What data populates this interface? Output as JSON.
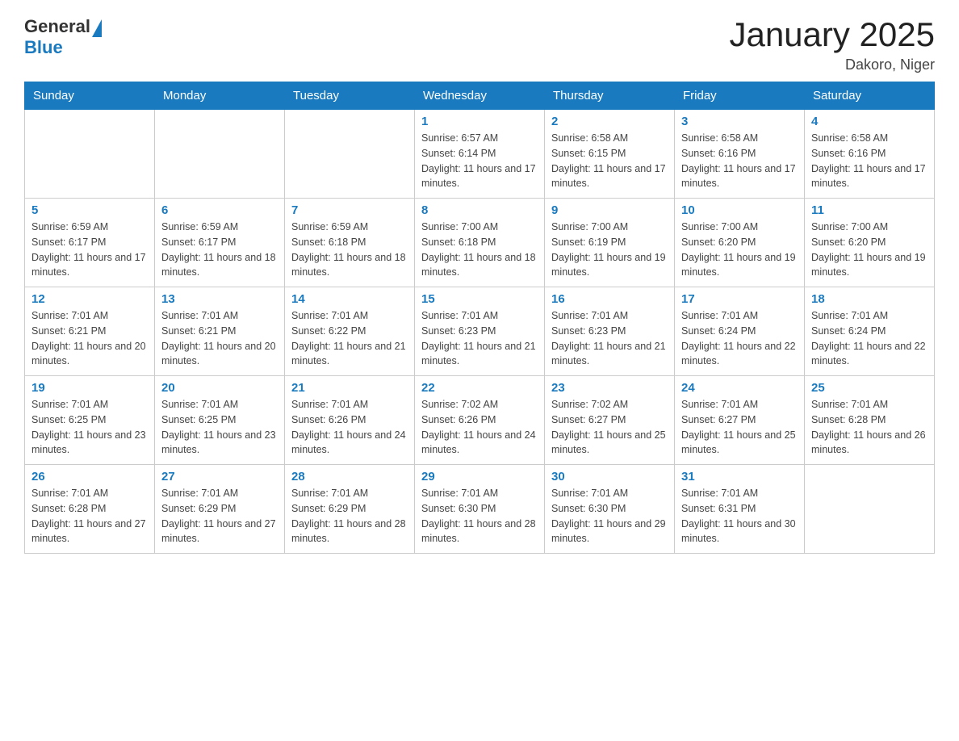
{
  "header": {
    "logo_general": "General",
    "logo_blue": "Blue",
    "title": "January 2025",
    "subtitle": "Dakoro, Niger"
  },
  "days_of_week": [
    "Sunday",
    "Monday",
    "Tuesday",
    "Wednesday",
    "Thursday",
    "Friday",
    "Saturday"
  ],
  "weeks": [
    [
      {
        "day": "",
        "info": ""
      },
      {
        "day": "",
        "info": ""
      },
      {
        "day": "",
        "info": ""
      },
      {
        "day": "1",
        "info": "Sunrise: 6:57 AM\nSunset: 6:14 PM\nDaylight: 11 hours and 17 minutes."
      },
      {
        "day": "2",
        "info": "Sunrise: 6:58 AM\nSunset: 6:15 PM\nDaylight: 11 hours and 17 minutes."
      },
      {
        "day": "3",
        "info": "Sunrise: 6:58 AM\nSunset: 6:16 PM\nDaylight: 11 hours and 17 minutes."
      },
      {
        "day": "4",
        "info": "Sunrise: 6:58 AM\nSunset: 6:16 PM\nDaylight: 11 hours and 17 minutes."
      }
    ],
    [
      {
        "day": "5",
        "info": "Sunrise: 6:59 AM\nSunset: 6:17 PM\nDaylight: 11 hours and 17 minutes."
      },
      {
        "day": "6",
        "info": "Sunrise: 6:59 AM\nSunset: 6:17 PM\nDaylight: 11 hours and 18 minutes."
      },
      {
        "day": "7",
        "info": "Sunrise: 6:59 AM\nSunset: 6:18 PM\nDaylight: 11 hours and 18 minutes."
      },
      {
        "day": "8",
        "info": "Sunrise: 7:00 AM\nSunset: 6:18 PM\nDaylight: 11 hours and 18 minutes."
      },
      {
        "day": "9",
        "info": "Sunrise: 7:00 AM\nSunset: 6:19 PM\nDaylight: 11 hours and 19 minutes."
      },
      {
        "day": "10",
        "info": "Sunrise: 7:00 AM\nSunset: 6:20 PM\nDaylight: 11 hours and 19 minutes."
      },
      {
        "day": "11",
        "info": "Sunrise: 7:00 AM\nSunset: 6:20 PM\nDaylight: 11 hours and 19 minutes."
      }
    ],
    [
      {
        "day": "12",
        "info": "Sunrise: 7:01 AM\nSunset: 6:21 PM\nDaylight: 11 hours and 20 minutes."
      },
      {
        "day": "13",
        "info": "Sunrise: 7:01 AM\nSunset: 6:21 PM\nDaylight: 11 hours and 20 minutes."
      },
      {
        "day": "14",
        "info": "Sunrise: 7:01 AM\nSunset: 6:22 PM\nDaylight: 11 hours and 21 minutes."
      },
      {
        "day": "15",
        "info": "Sunrise: 7:01 AM\nSunset: 6:23 PM\nDaylight: 11 hours and 21 minutes."
      },
      {
        "day": "16",
        "info": "Sunrise: 7:01 AM\nSunset: 6:23 PM\nDaylight: 11 hours and 21 minutes."
      },
      {
        "day": "17",
        "info": "Sunrise: 7:01 AM\nSunset: 6:24 PM\nDaylight: 11 hours and 22 minutes."
      },
      {
        "day": "18",
        "info": "Sunrise: 7:01 AM\nSunset: 6:24 PM\nDaylight: 11 hours and 22 minutes."
      }
    ],
    [
      {
        "day": "19",
        "info": "Sunrise: 7:01 AM\nSunset: 6:25 PM\nDaylight: 11 hours and 23 minutes."
      },
      {
        "day": "20",
        "info": "Sunrise: 7:01 AM\nSunset: 6:25 PM\nDaylight: 11 hours and 23 minutes."
      },
      {
        "day": "21",
        "info": "Sunrise: 7:01 AM\nSunset: 6:26 PM\nDaylight: 11 hours and 24 minutes."
      },
      {
        "day": "22",
        "info": "Sunrise: 7:02 AM\nSunset: 6:26 PM\nDaylight: 11 hours and 24 minutes."
      },
      {
        "day": "23",
        "info": "Sunrise: 7:02 AM\nSunset: 6:27 PM\nDaylight: 11 hours and 25 minutes."
      },
      {
        "day": "24",
        "info": "Sunrise: 7:01 AM\nSunset: 6:27 PM\nDaylight: 11 hours and 25 minutes."
      },
      {
        "day": "25",
        "info": "Sunrise: 7:01 AM\nSunset: 6:28 PM\nDaylight: 11 hours and 26 minutes."
      }
    ],
    [
      {
        "day": "26",
        "info": "Sunrise: 7:01 AM\nSunset: 6:28 PM\nDaylight: 11 hours and 27 minutes."
      },
      {
        "day": "27",
        "info": "Sunrise: 7:01 AM\nSunset: 6:29 PM\nDaylight: 11 hours and 27 minutes."
      },
      {
        "day": "28",
        "info": "Sunrise: 7:01 AM\nSunset: 6:29 PM\nDaylight: 11 hours and 28 minutes."
      },
      {
        "day": "29",
        "info": "Sunrise: 7:01 AM\nSunset: 6:30 PM\nDaylight: 11 hours and 28 minutes."
      },
      {
        "day": "30",
        "info": "Sunrise: 7:01 AM\nSunset: 6:30 PM\nDaylight: 11 hours and 29 minutes."
      },
      {
        "day": "31",
        "info": "Sunrise: 7:01 AM\nSunset: 6:31 PM\nDaylight: 11 hours and 30 minutes."
      },
      {
        "day": "",
        "info": ""
      }
    ]
  ]
}
